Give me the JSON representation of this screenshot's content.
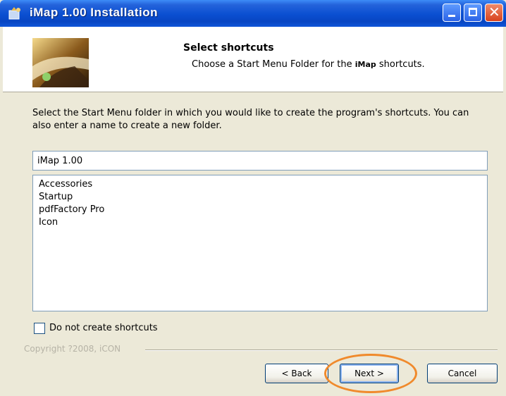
{
  "window": {
    "title": "iMap 1.00 Installation",
    "colors": {
      "titlebar": "#0a4fd1",
      "close": "#d8421e",
      "highlight": "#f08a2c"
    }
  },
  "header": {
    "title": "Select shortcuts",
    "subtitle_pre": "Choose a Start Menu Folder for the",
    "subtitle_app": "iMap",
    "subtitle_post": "shortcuts."
  },
  "body": {
    "instructions": "Select the Start Menu folder in which you would like to create the program's shortcuts. You can also enter a name to create a new folder.",
    "folder_input": {
      "value": "iMap 1.00"
    },
    "folder_list": [
      "Accessories",
      "Startup",
      "pdfFactory Pro",
      "Icon"
    ],
    "checkbox": {
      "label": "Do not create shortcuts",
      "checked": false
    },
    "copyright": "Copyright ?2008, iCON"
  },
  "buttons": {
    "back": "< Back",
    "next": "Next >",
    "cancel": "Cancel"
  }
}
